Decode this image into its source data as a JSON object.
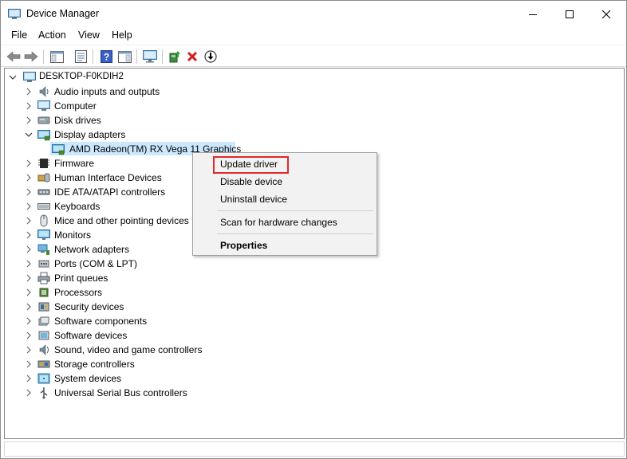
{
  "window": {
    "title": "Device Manager"
  },
  "menu": [
    "File",
    "Action",
    "View",
    "Help"
  ],
  "toolbar_icons": [
    "back-arrow-icon",
    "forward-arrow-icon",
    "show-hide-console-tree-icon",
    "properties-icon",
    "help-icon",
    "action-pane-icon",
    "computer-monitor-icon",
    "update-driver-icon",
    "uninstall-device-icon",
    "scan-hardware-icon"
  ],
  "tree": {
    "root": "DESKTOP-F0KDIH2",
    "categories": [
      "Audio inputs and outputs",
      "Computer",
      "Disk drives",
      "Display adapters",
      "Firmware",
      "Human Interface Devices",
      "IDE ATA/ATAPI controllers",
      "Keyboards",
      "Mice and other pointing devices",
      "Monitors",
      "Network adapters",
      "Ports (COM & LPT)",
      "Print queues",
      "Processors",
      "Security devices",
      "Software components",
      "Software devices",
      "Sound, video and game controllers",
      "Storage controllers",
      "System devices",
      "Universal Serial Bus controllers"
    ],
    "expanded_category": "Display adapters",
    "child": "AMD Radeon(TM) RX Vega 11 Graphics"
  },
  "context_menu": {
    "update_driver": "Update driver",
    "disable_device": "Disable device",
    "uninstall_device": "Uninstall device",
    "scan_hardware": "Scan for hardware changes",
    "properties": "Properties"
  },
  "colors": {
    "selection": "#cce8ff",
    "highlight_box": "#e0282d"
  }
}
